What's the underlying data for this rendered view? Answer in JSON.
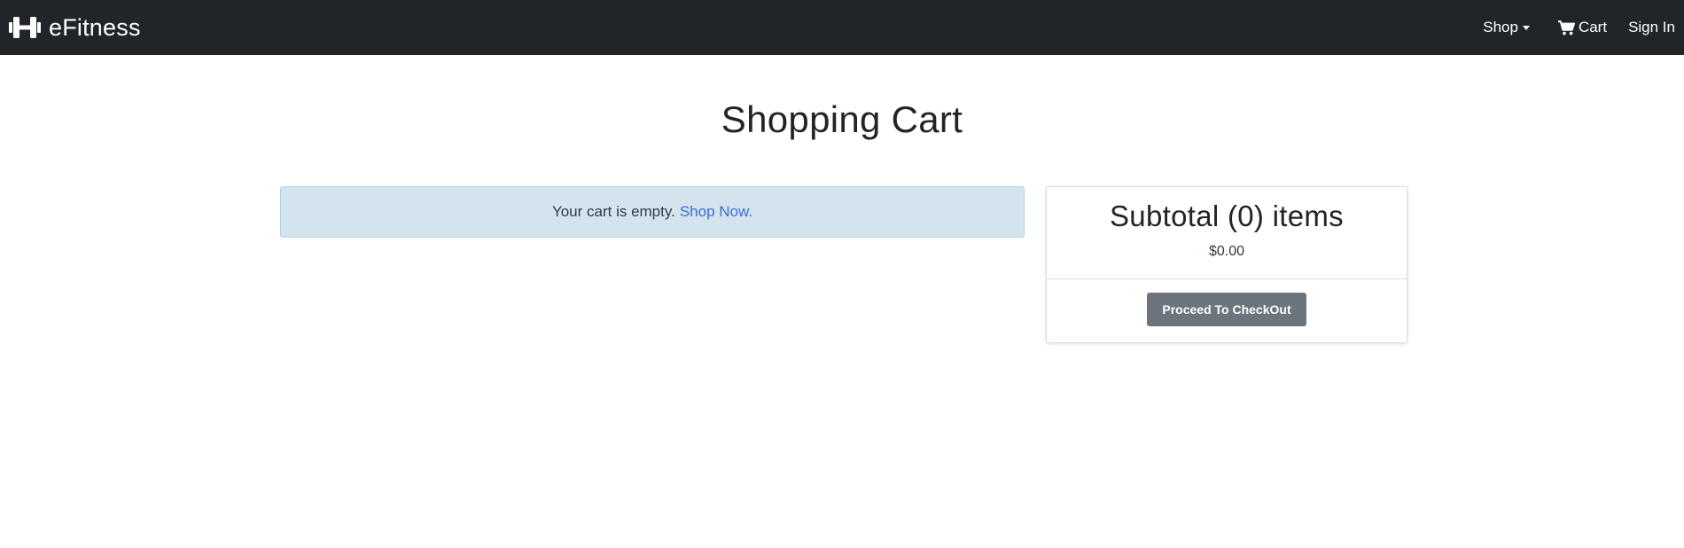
{
  "navbar": {
    "brand": {
      "name": "eFitness",
      "icon": "dumbbell-icon"
    },
    "items": {
      "shop": {
        "label": "Shop",
        "icon": "caret-down-icon"
      },
      "cart": {
        "label": "Cart",
        "icon": "shopping-cart-icon"
      },
      "sign_in": {
        "label": "Sign In"
      }
    }
  },
  "main": {
    "title": "Shopping Cart",
    "empty_alert": {
      "message": "Your cart is empty.",
      "link_label": "Shop Now."
    },
    "summary": {
      "heading": "Subtotal (0) items",
      "price": "$0.00",
      "checkout_label": "Proceed To CheckOut"
    }
  },
  "colors": {
    "navbar_bg": "#212529",
    "alert_bg": "#d4e4ef",
    "link": "#3c6cd4",
    "button_bg": "#6c757d"
  }
}
